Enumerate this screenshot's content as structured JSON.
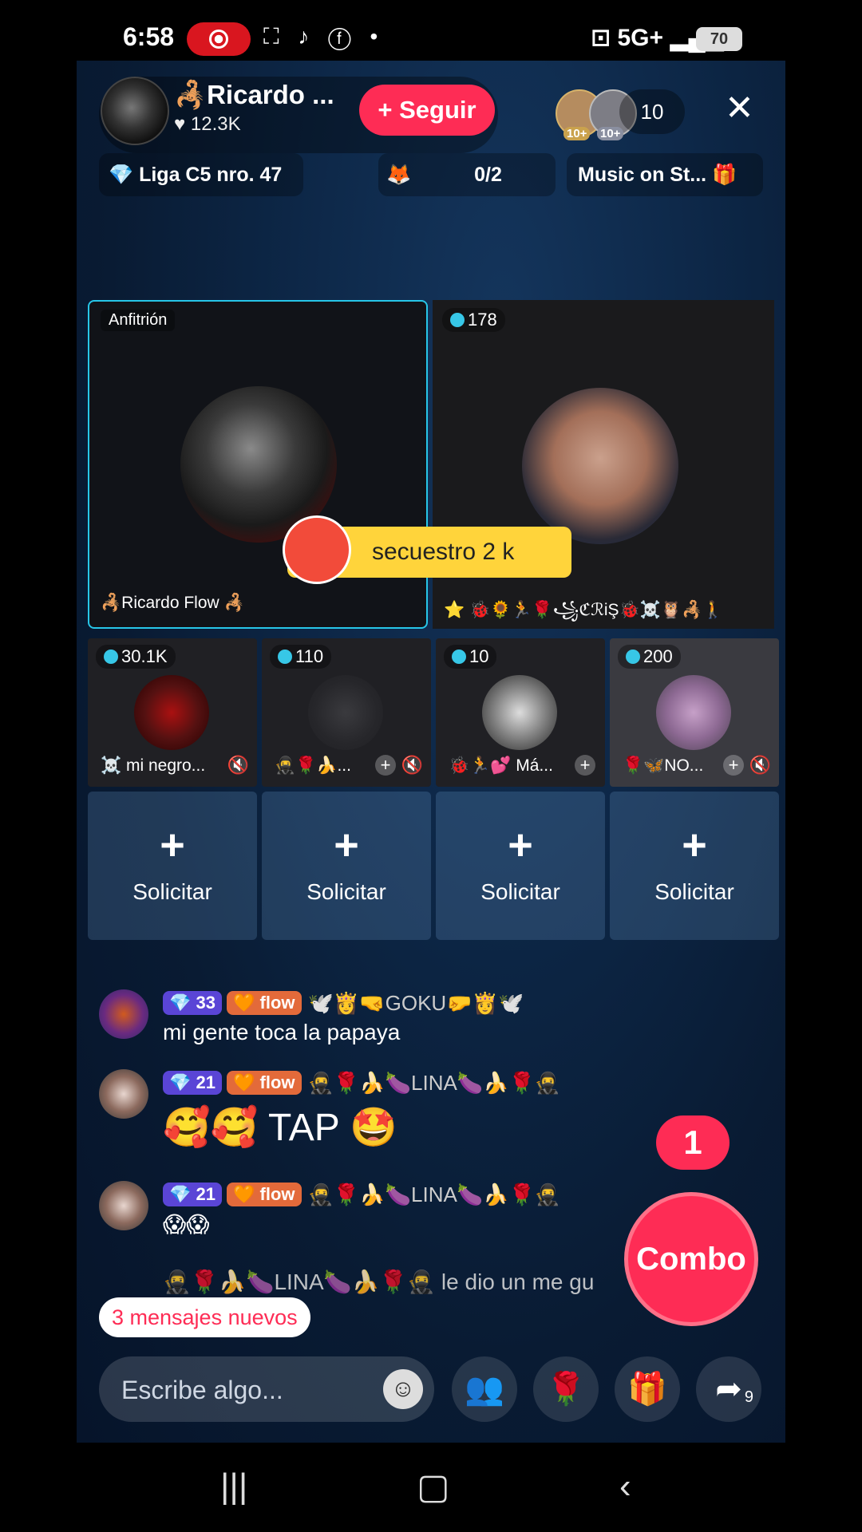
{
  "status_bar": {
    "time": "6:58",
    "network": "5G+",
    "battery": "70"
  },
  "header": {
    "host_name": "🦂Ricardo ...",
    "likes": "♥ 12.3K",
    "follow_label": "+ Seguir",
    "viewer_badge_1": "10+",
    "viewer_badge_2": "10+",
    "viewer_count": "10",
    "close_icon": "✕"
  },
  "chips": {
    "league": "Liga C5 nro. 47",
    "progress": "0/2",
    "music": "Music on St..."
  },
  "host_tile": {
    "label": "Anfitrión",
    "name": "🦂Ricardo Flow 🦂"
  },
  "guest_tile": {
    "score": "178",
    "name": "⭐ 🐞🌻🏃🌹꧁ℭℛiŞ🐞☠️🦉🦂🚶"
  },
  "sticker": {
    "text": "secuestro 2 k"
  },
  "small_tiles": [
    {
      "score": "30.1K",
      "name": "☠️ mi negro..."
    },
    {
      "score": "110",
      "name": "🥷🌹🍌..."
    },
    {
      "score": "10",
      "name": "🐞🏃💕 Má..."
    },
    {
      "score": "200",
      "name": "🌹🦋NO..."
    }
  ],
  "request_tiles": [
    {
      "plus": "+",
      "label": "Solicitar"
    },
    {
      "plus": "+",
      "label": "Solicitar"
    },
    {
      "plus": "+",
      "label": "Solicitar"
    },
    {
      "plus": "+",
      "label": "Solicitar"
    }
  ],
  "chat": [
    {
      "level": "33",
      "fan": "flow",
      "user": "🕊️👸🤜GOKU🤛👸🕊️",
      "text": "mi gente toca la papaya"
    },
    {
      "level": "21",
      "fan": "flow",
      "user": "🥷🌹🍌🍆LINA🍆🍌🌹🥷",
      "text": "🥰🥰 TAP 🤩"
    },
    {
      "level": "21",
      "fan": "flow",
      "user": "🥷🌹🍌🍆LINA🍆🍌🌹🥷",
      "text": "😱😱"
    },
    {
      "text": "🥷🌹🍌🍆LINA🍆🍌🌹🥷 le dio un me gu"
    }
  ],
  "new_messages": "3 mensajes nuevos",
  "combo": {
    "count": "1",
    "label": "Combo"
  },
  "input": {
    "placeholder": "Escribe algo..."
  },
  "share_count": "9",
  "colors": {
    "accent": "#fe2c55",
    "tile_border": "#27c6e8",
    "sticker": "#ffd43b"
  }
}
